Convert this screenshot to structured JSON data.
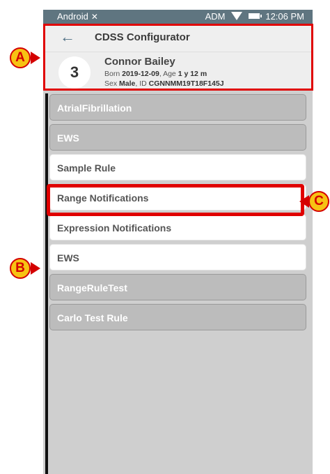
{
  "statusbar": {
    "carrier": "Android",
    "no_signal_icon": "no-signal-icon",
    "user": "ADM",
    "time": "12:06 PM"
  },
  "toolbar": {
    "back_icon": "back-arrow-icon",
    "back_glyph": "←",
    "title": "CDSS Configurator"
  },
  "patient": {
    "bed": "3",
    "name": "Connor Bailey",
    "born_label": "Born",
    "born": "2019-12-09",
    "age_label": ", Age",
    "age": "1 y 12 m",
    "sex_label": "Sex",
    "sex": "Male",
    "id_label": ", ID",
    "id": "CGNNMM19T18F145J"
  },
  "rules": [
    {
      "label": "AtrialFibrillation",
      "state": "disabled"
    },
    {
      "label": "EWS",
      "state": "disabled"
    },
    {
      "label": "Sample Rule",
      "state": "enabled"
    },
    {
      "label": "Range Notifications",
      "state": "enabled"
    },
    {
      "label": "Expression Notifications",
      "state": "enabled"
    },
    {
      "label": "EWS",
      "state": "enabled"
    },
    {
      "label": "RangeRuleTest",
      "state": "disabled"
    },
    {
      "label": "Carlo Test Rule",
      "state": "disabled"
    }
  ],
  "annotations": {
    "a": "A",
    "b": "B",
    "c": "C",
    "highlight_color": "#e00000",
    "callout_fill": "#f7c213"
  },
  "colors": {
    "statusbar": "#5f7580",
    "accent": "#4e6f84",
    "list_background": "#cfcfcf",
    "disabled_rule": "#bcbcbc",
    "enabled_rule": "#ffffff"
  }
}
